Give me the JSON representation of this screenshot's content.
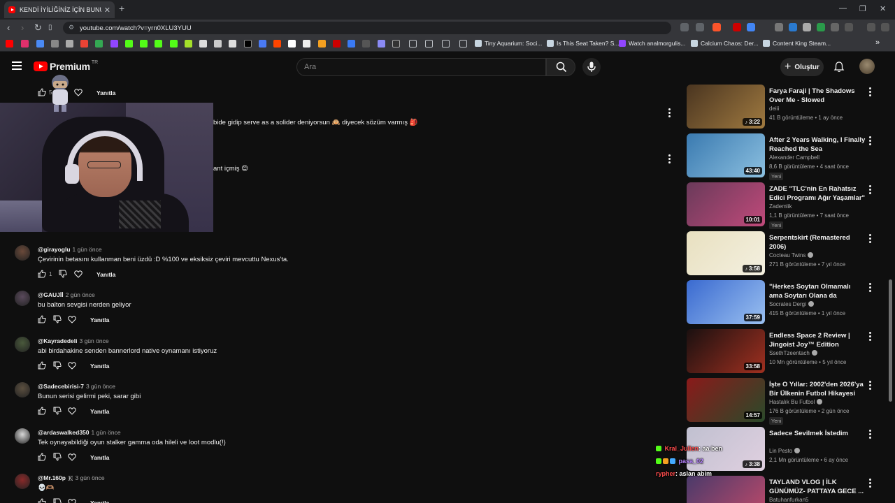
{
  "browser": {
    "tab_title": "KENDİ İYİLİĞİNİZ İÇİN BUNU OYNAYIN",
    "tab_close": "✕",
    "new_tab": "+",
    "url": "youtube.com/watch?v=yrn0XLU3YUU",
    "bookmarks": [
      {
        "label": "Tiny Aquarium: Soci...",
        "color": "#ffffff"
      },
      {
        "label": "Is This Seat Taken? S...",
        "color": "#c7d5e0"
      },
      {
        "label": "Watch analmorgulis...",
        "color": "#9146ff"
      },
      {
        "label": "Calcium Chaos: Der...",
        "color": "#c7d5e0"
      },
      {
        "label": "Content King Steam...",
        "color": "#c7d5e0"
      }
    ],
    "bookmarks_more": "»"
  },
  "youtube": {
    "logo_text": "Premium",
    "logo_country": "TR",
    "search_placeholder": "Ara",
    "create_label": "Oluştur"
  },
  "partial_comments": {
    "like_count": "5",
    "reply_label": "Yanıtla",
    "line1": "bide gidip serve as a solider deniyorsun 🙉 diyecek sözüm varmış 🎒",
    "line2": "ant içmiş 😊"
  },
  "comments": [
    {
      "user": "@girayoglu",
      "time": "1 gün önce",
      "text": "Çevirinin betasını kullanman beni üzdü :D %100 ve eksiksiz çeviri mevcuttu Nexus'ta.",
      "likes": "1",
      "reply": "Yanıtla",
      "avatar_color": "#6b4a3a"
    },
    {
      "user": "@GAUJİİ",
      "time": "2 gün önce",
      "text": "bu balton sevgisi nerden geliyor",
      "likes": "",
      "reply": "Yanıtla",
      "avatar_color": "#5a4a5c"
    },
    {
      "user": "@Kayradedeli",
      "time": "3 gün önce",
      "text": "abi birdahakine senden bannerlord native oynamanı istiyoruz",
      "likes": "",
      "reply": "Yanıtla",
      "avatar_color": "#4a5a3c"
    },
    {
      "user": "@Sadecebirisi-7",
      "time": "3 gün önce",
      "text": "Bunun serisi gelirmi peki, sarar gibi",
      "likes": "",
      "reply": "Yanıtla",
      "avatar_color": "#5c5040"
    },
    {
      "user": "@ardaswalked350",
      "time": "1 gün önce",
      "text": "Tek oynayabildiği oyun stalker gamma oda hileli ve loot modlu(!)",
      "likes": "",
      "reply": "Yanıtla",
      "avatar_color": "#d8d8d8"
    },
    {
      "user": "@Mr.160p",
      "time": "3 gün önce",
      "text": "💀🫶🏽",
      "likes": "",
      "reply": "Yanıtla",
      "avatar_color": "#8a2a2a",
      "badge": "🇰"
    }
  ],
  "videos": [
    {
      "title": "Farya Faraji | The Shadows Over Me - Slowed",
      "channel": "deiii",
      "verified": false,
      "views": "41 B görüntüleme",
      "age": "1 ay önce",
      "duration": "3:22",
      "short": true,
      "badge": "",
      "thumb": [
        "#4a3520",
        "#a07a40"
      ]
    },
    {
      "title": "After 2 Years Walking, I Finally Reached the Sea",
      "channel": "Alexander Campbell",
      "verified": false,
      "views": "8,6 B görüntüleme",
      "age": "4 saat önce",
      "duration": "43:40",
      "short": false,
      "badge": "Yeni",
      "thumb": [
        "#3a7ab0",
        "#8cc0e0"
      ]
    },
    {
      "title": "ZADE \"TLC'nin En Rahatsız Edici Programı Ağır Yaşamlar\" ...",
      "channel": "Zademlik",
      "verified": false,
      "views": "1,1 B görüntüleme",
      "age": "7 saat önce",
      "duration": "10:01",
      "short": false,
      "badge": "Yeni",
      "thumb": [
        "#6a3a5a",
        "#c04a7a"
      ]
    },
    {
      "title": "Serpentskirt (Remastered 2006)",
      "channel": "Cocteau Twins",
      "verified": true,
      "views": "271 B görüntüleme",
      "age": "7 yıl önce",
      "duration": "3:58",
      "short": true,
      "badge": "",
      "thumb": [
        "#e8e0c0",
        "#f4f0e0"
      ]
    },
    {
      "title": "\"Herkes Soytarı Olmamalı ama Soytarı Olana da Karışılmamal...",
      "channel": "Socrates Dergi",
      "verified": true,
      "views": "415 B görüntüleme",
      "age": "1 yıl önce",
      "duration": "37:59",
      "short": false,
      "badge": "",
      "thumb": [
        "#3a6ad0",
        "#9ac0f0"
      ]
    },
    {
      "title": "Endless Space 2 Review | Jingoist Joy™ Edition",
      "channel": "SsethTzeentach",
      "verified": true,
      "views": "10 Mn görüntüleme",
      "age": "5 yıl önce",
      "duration": "33:58",
      "short": false,
      "badge": "",
      "thumb": [
        "#1a1010",
        "#a03020"
      ]
    },
    {
      "title": "İşte O Yıllar: 2002'den 2026'ya Bir Ülkenin Futbol Hikayesi",
      "channel": "Hastalık Bu Futbol",
      "verified": true,
      "views": "176 B görüntüleme",
      "age": "2 gün önce",
      "duration": "14:57",
      "short": false,
      "badge": "Yeni",
      "thumb": [
        "#8a1a1a",
        "#2a4a2a"
      ]
    },
    {
      "title": "Sadece Sevilmek İstedim",
      "channel": "Lin Pesto",
      "verified": true,
      "views": "2,1 Mn görüntüleme",
      "age": "6 ay önce",
      "duration": "3:38",
      "short": true,
      "badge": "",
      "thumb": [
        "#c0c0d0",
        "#e0d0e0"
      ]
    },
    {
      "title": "TAYLAND VLOG | İLK GÜNÜMÜZ- PATTAYA GECE ...",
      "channel": "Batuhanfurkan5",
      "verified": false,
      "views": "",
      "age": "",
      "duration": "",
      "short": false,
      "badge": "",
      "thumb": [
        "#4a3a6a",
        "#c04a6a"
      ]
    }
  ],
  "chat": [
    {
      "user": "Kral_Julien",
      "msg": ": aa ben"
    },
    {
      "user": "pasa_02",
      "msg": ""
    },
    {
      "user": "rypher",
      "msg": ": aslan abim"
    }
  ]
}
